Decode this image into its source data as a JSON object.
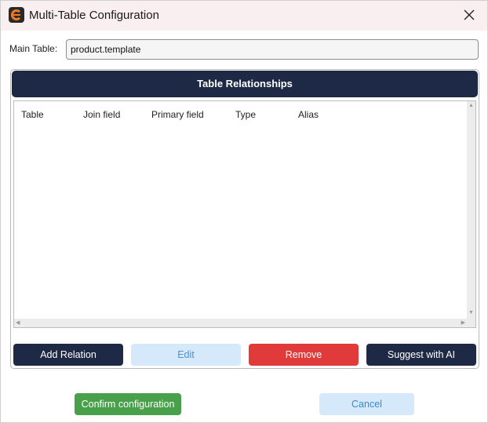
{
  "window": {
    "title": "Multi-Table Configuration"
  },
  "main_table": {
    "label": "Main Table:",
    "value": "product.template"
  },
  "relationships": {
    "header": "Table Relationships",
    "columns": [
      "Table",
      "Join field",
      "Primary field",
      "Type",
      "Alias"
    ],
    "rows": []
  },
  "buttons": {
    "add_relation": "Add Relation",
    "edit": "Edit",
    "remove": "Remove",
    "suggest_ai": "Suggest with AI",
    "confirm": "Confirm configuration",
    "cancel": "Cancel"
  },
  "colors": {
    "header_bg": "#1e2a45",
    "danger": "#e03a3a",
    "success": "#48a04a",
    "secondary": "#d6e9fb",
    "titlebar_bg": "#f9eef0"
  }
}
